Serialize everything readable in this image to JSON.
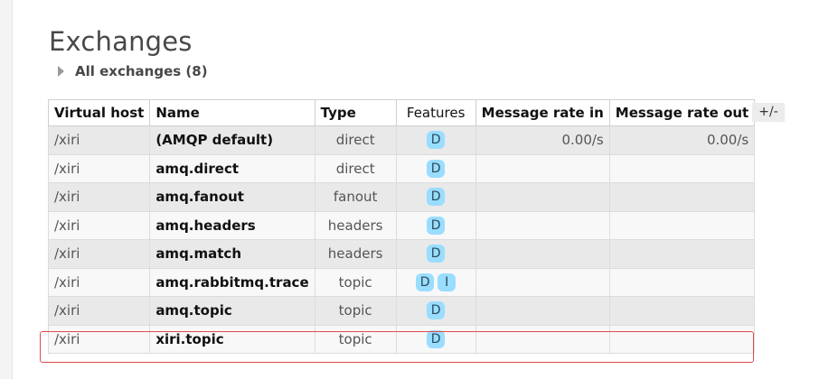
{
  "page": {
    "title": "Exchanges",
    "section_label": "All exchanges (8)",
    "columns_toggle": "+/-"
  },
  "table": {
    "headers": {
      "vhost": "Virtual host",
      "name": "Name",
      "type": "Type",
      "features": "Features",
      "rate_in": "Message rate in",
      "rate_out": "Message rate out"
    },
    "rows": [
      {
        "vhost": "/xiri",
        "name": "(AMQP default)",
        "type": "direct",
        "features": [
          "D"
        ],
        "rate_in": "0.00/s",
        "rate_out": "0.00/s"
      },
      {
        "vhost": "/xiri",
        "name": "amq.direct",
        "type": "direct",
        "features": [
          "D"
        ],
        "rate_in": "",
        "rate_out": ""
      },
      {
        "vhost": "/xiri",
        "name": "amq.fanout",
        "type": "fanout",
        "features": [
          "D"
        ],
        "rate_in": "",
        "rate_out": ""
      },
      {
        "vhost": "/xiri",
        "name": "amq.headers",
        "type": "headers",
        "features": [
          "D"
        ],
        "rate_in": "",
        "rate_out": ""
      },
      {
        "vhost": "/xiri",
        "name": "amq.match",
        "type": "headers",
        "features": [
          "D"
        ],
        "rate_in": "",
        "rate_out": ""
      },
      {
        "vhost": "/xiri",
        "name": "amq.rabbitmq.trace",
        "type": "topic",
        "features": [
          "D",
          "I"
        ],
        "rate_in": "",
        "rate_out": ""
      },
      {
        "vhost": "/xiri",
        "name": "amq.topic",
        "type": "topic",
        "features": [
          "D"
        ],
        "rate_in": "",
        "rate_out": ""
      },
      {
        "vhost": "/xiri",
        "name": "xiri.topic",
        "type": "topic",
        "features": [
          "D"
        ],
        "rate_in": "",
        "rate_out": ""
      }
    ]
  },
  "colors": {
    "badge": "#99ddff",
    "highlight": "#e04a4a",
    "row_odd": "#e9e9e9",
    "row_even": "#f8f8f8"
  },
  "icons": {
    "section_toggle": "triangle-right-icon"
  }
}
